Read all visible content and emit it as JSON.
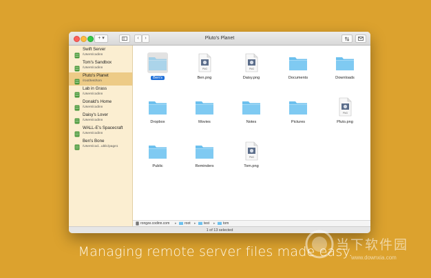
{
  "window": {
    "title": "Pluto's Planet",
    "add_button_label": "+ ▾"
  },
  "sidebar": {
    "servers": [
      {
        "name": "Swift Server",
        "path": "/Users/codinn"
      },
      {
        "name": "Tom's Sandbox",
        "path": "/Users/codinn"
      },
      {
        "name": "Pluto's Planet",
        "path": "/root/test/tom",
        "selected": true
      },
      {
        "name": "Lab in Grass",
        "path": "/Users/codinn"
      },
      {
        "name": "Donald's Home",
        "path": "/Users/codinn"
      },
      {
        "name": "Daisy's Lover",
        "path": "/Users/codinn"
      },
      {
        "name": "WALL-E's Spacecraft",
        "path": "/Users/codinn"
      },
      {
        "name": "Ben's Bone",
        "path": "/Users/cod...ublic/page1"
      }
    ]
  },
  "files": [
    {
      "name": "Ben's",
      "kind": "folder-icon",
      "selected": true
    },
    {
      "name": "Ben.png",
      "kind": "png-icon"
    },
    {
      "name": "Daisy.png",
      "kind": "png-icon"
    },
    {
      "name": "Documents",
      "kind": "folder-icon"
    },
    {
      "name": "Downloads",
      "kind": "folder-icon"
    },
    {
      "name": "Dropbox",
      "kind": "folder-icon"
    },
    {
      "name": "Movies",
      "kind": "folder-icon"
    },
    {
      "name": "Notes",
      "kind": "folder-icon"
    },
    {
      "name": "Pictures",
      "kind": "folder-icon"
    },
    {
      "name": "Pluto.png",
      "kind": "png-icon"
    },
    {
      "name": "Public",
      "kind": "folder-icon"
    },
    {
      "name": "Reminders",
      "kind": "folder-icon"
    },
    {
      "name": "Tom.png",
      "kind": "png-icon"
    }
  ],
  "png_badge": "PNG",
  "pathbar": {
    "host": "rongze.codinn.com",
    "segments": [
      "root",
      "test",
      "tom"
    ]
  },
  "status": "1 of 13 selected",
  "caption": "Managing remote server files made easy.",
  "watermark": {
    "site": "当下软件园",
    "url": "www.downxia.com"
  },
  "colors": {
    "background": "#dca22e",
    "sidebar": "#fbeed1",
    "sidebar_selected": "#edcb87",
    "folder": "#6cc0ee",
    "selection": "#1f6fd8",
    "server_icon": "#4d9a3e"
  }
}
